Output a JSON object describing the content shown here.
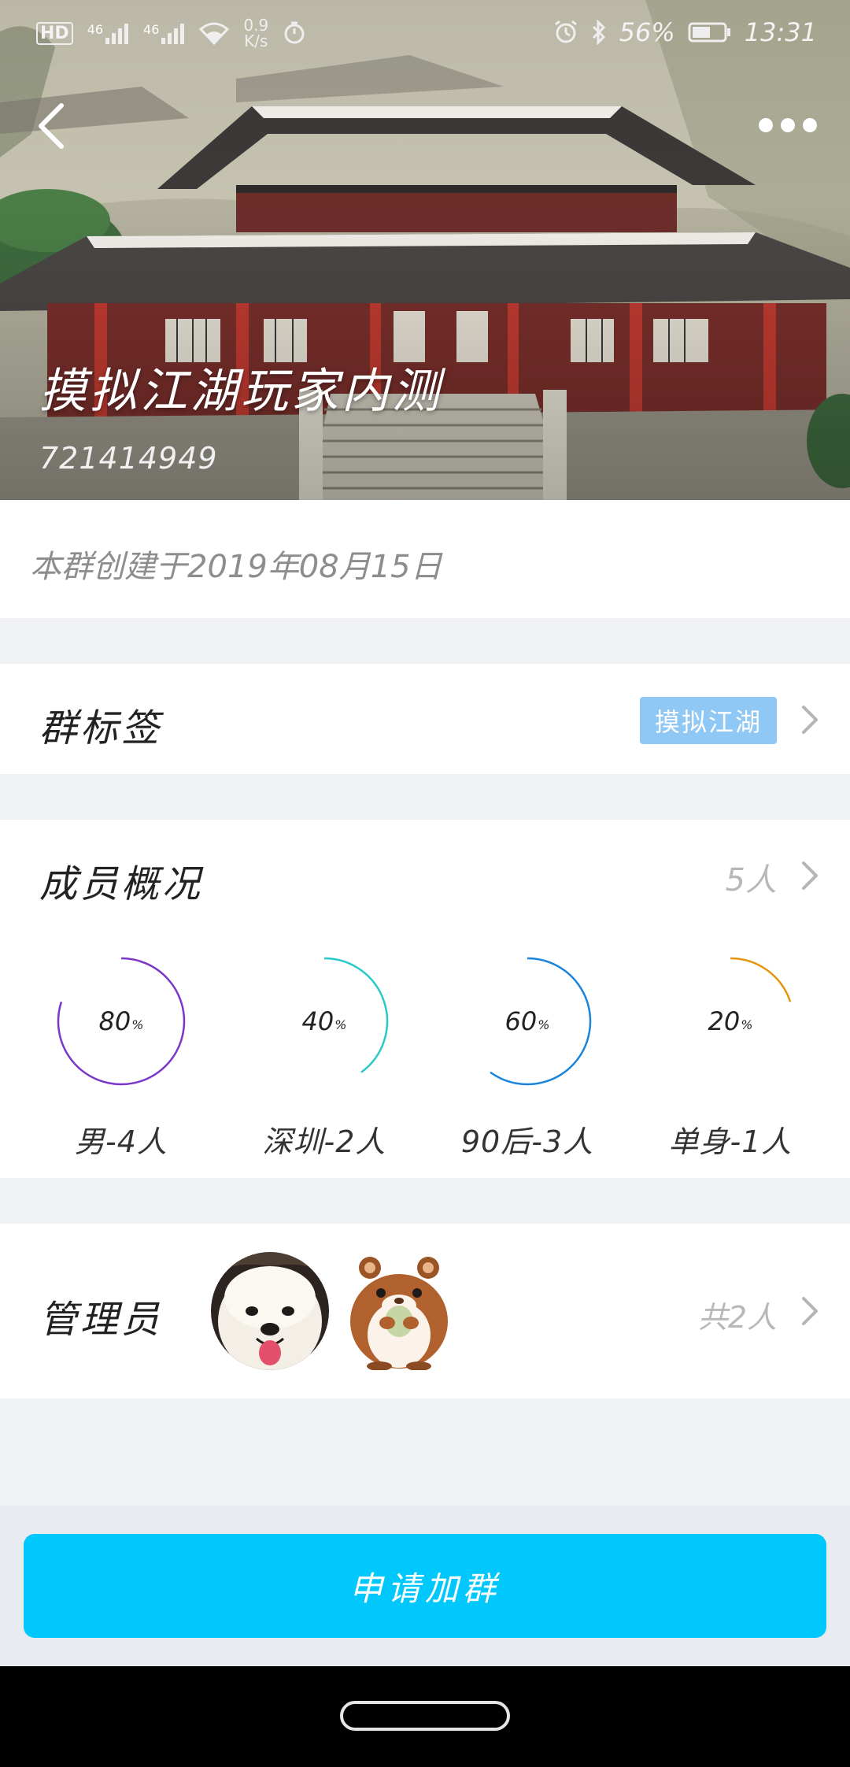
{
  "status_bar": {
    "hd_label": "HD",
    "sim1": "46",
    "sim2": "46",
    "speed_value": "0.9",
    "speed_unit": "K/s",
    "battery": "56%",
    "time": "13:31"
  },
  "header": {
    "group_name": "摸拟江湖玩家内测",
    "group_id": "721414949"
  },
  "created_text": "本群创建于2019年08月15日",
  "tag_section": {
    "title": "群标签",
    "tag": "摸拟江湖"
  },
  "member_section": {
    "title": "成员概况",
    "count": "5人",
    "stats": [
      {
        "percent": 80,
        "percent_label": "80",
        "unit": "%",
        "label": "男-4人",
        "color": "#7a37c9"
      },
      {
        "percent": 40,
        "percent_label": "40",
        "unit": "%",
        "label": "深圳-2人",
        "color": "#2ac9c9"
      },
      {
        "percent": 60,
        "percent_label": "60",
        "unit": "%",
        "label": "90后-3人",
        "color": "#1b84db"
      },
      {
        "percent": 20,
        "percent_label": "20",
        "unit": "%",
        "label": "单身-1人",
        "color": "#e2950d"
      }
    ]
  },
  "admin_section": {
    "title": "管理员",
    "count": "共2人"
  },
  "join_button": "申请加群"
}
